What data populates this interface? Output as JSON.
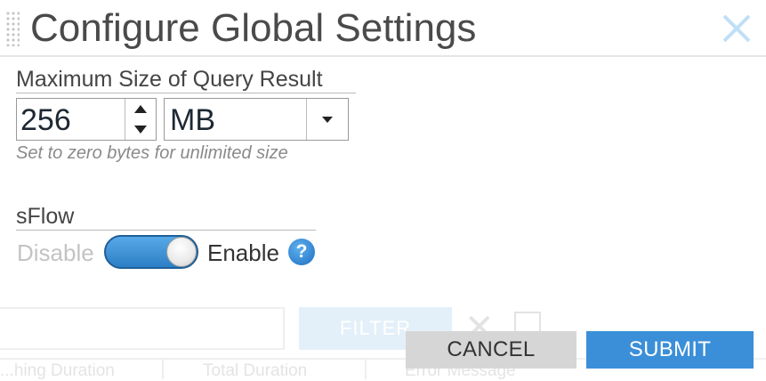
{
  "dialog": {
    "title": "Configure Global Settings",
    "close_icon": "close-icon",
    "accent_color": "#3b8fd8"
  },
  "query_size": {
    "label": "Maximum Size of Query Result",
    "value": "256",
    "unit": "MB",
    "hint": "Set to zero bytes for unlimited size"
  },
  "sflow": {
    "label": "sFlow",
    "off_label": "Disable",
    "on_label": "Enable",
    "enabled": true,
    "help_icon": "?"
  },
  "buttons": {
    "cancel": "CANCEL",
    "submit": "SUBMIT"
  },
  "background": {
    "filter_label": "FILTER",
    "columns": [
      "...hing Duration",
      "Total Duration",
      "Error Message"
    ]
  }
}
